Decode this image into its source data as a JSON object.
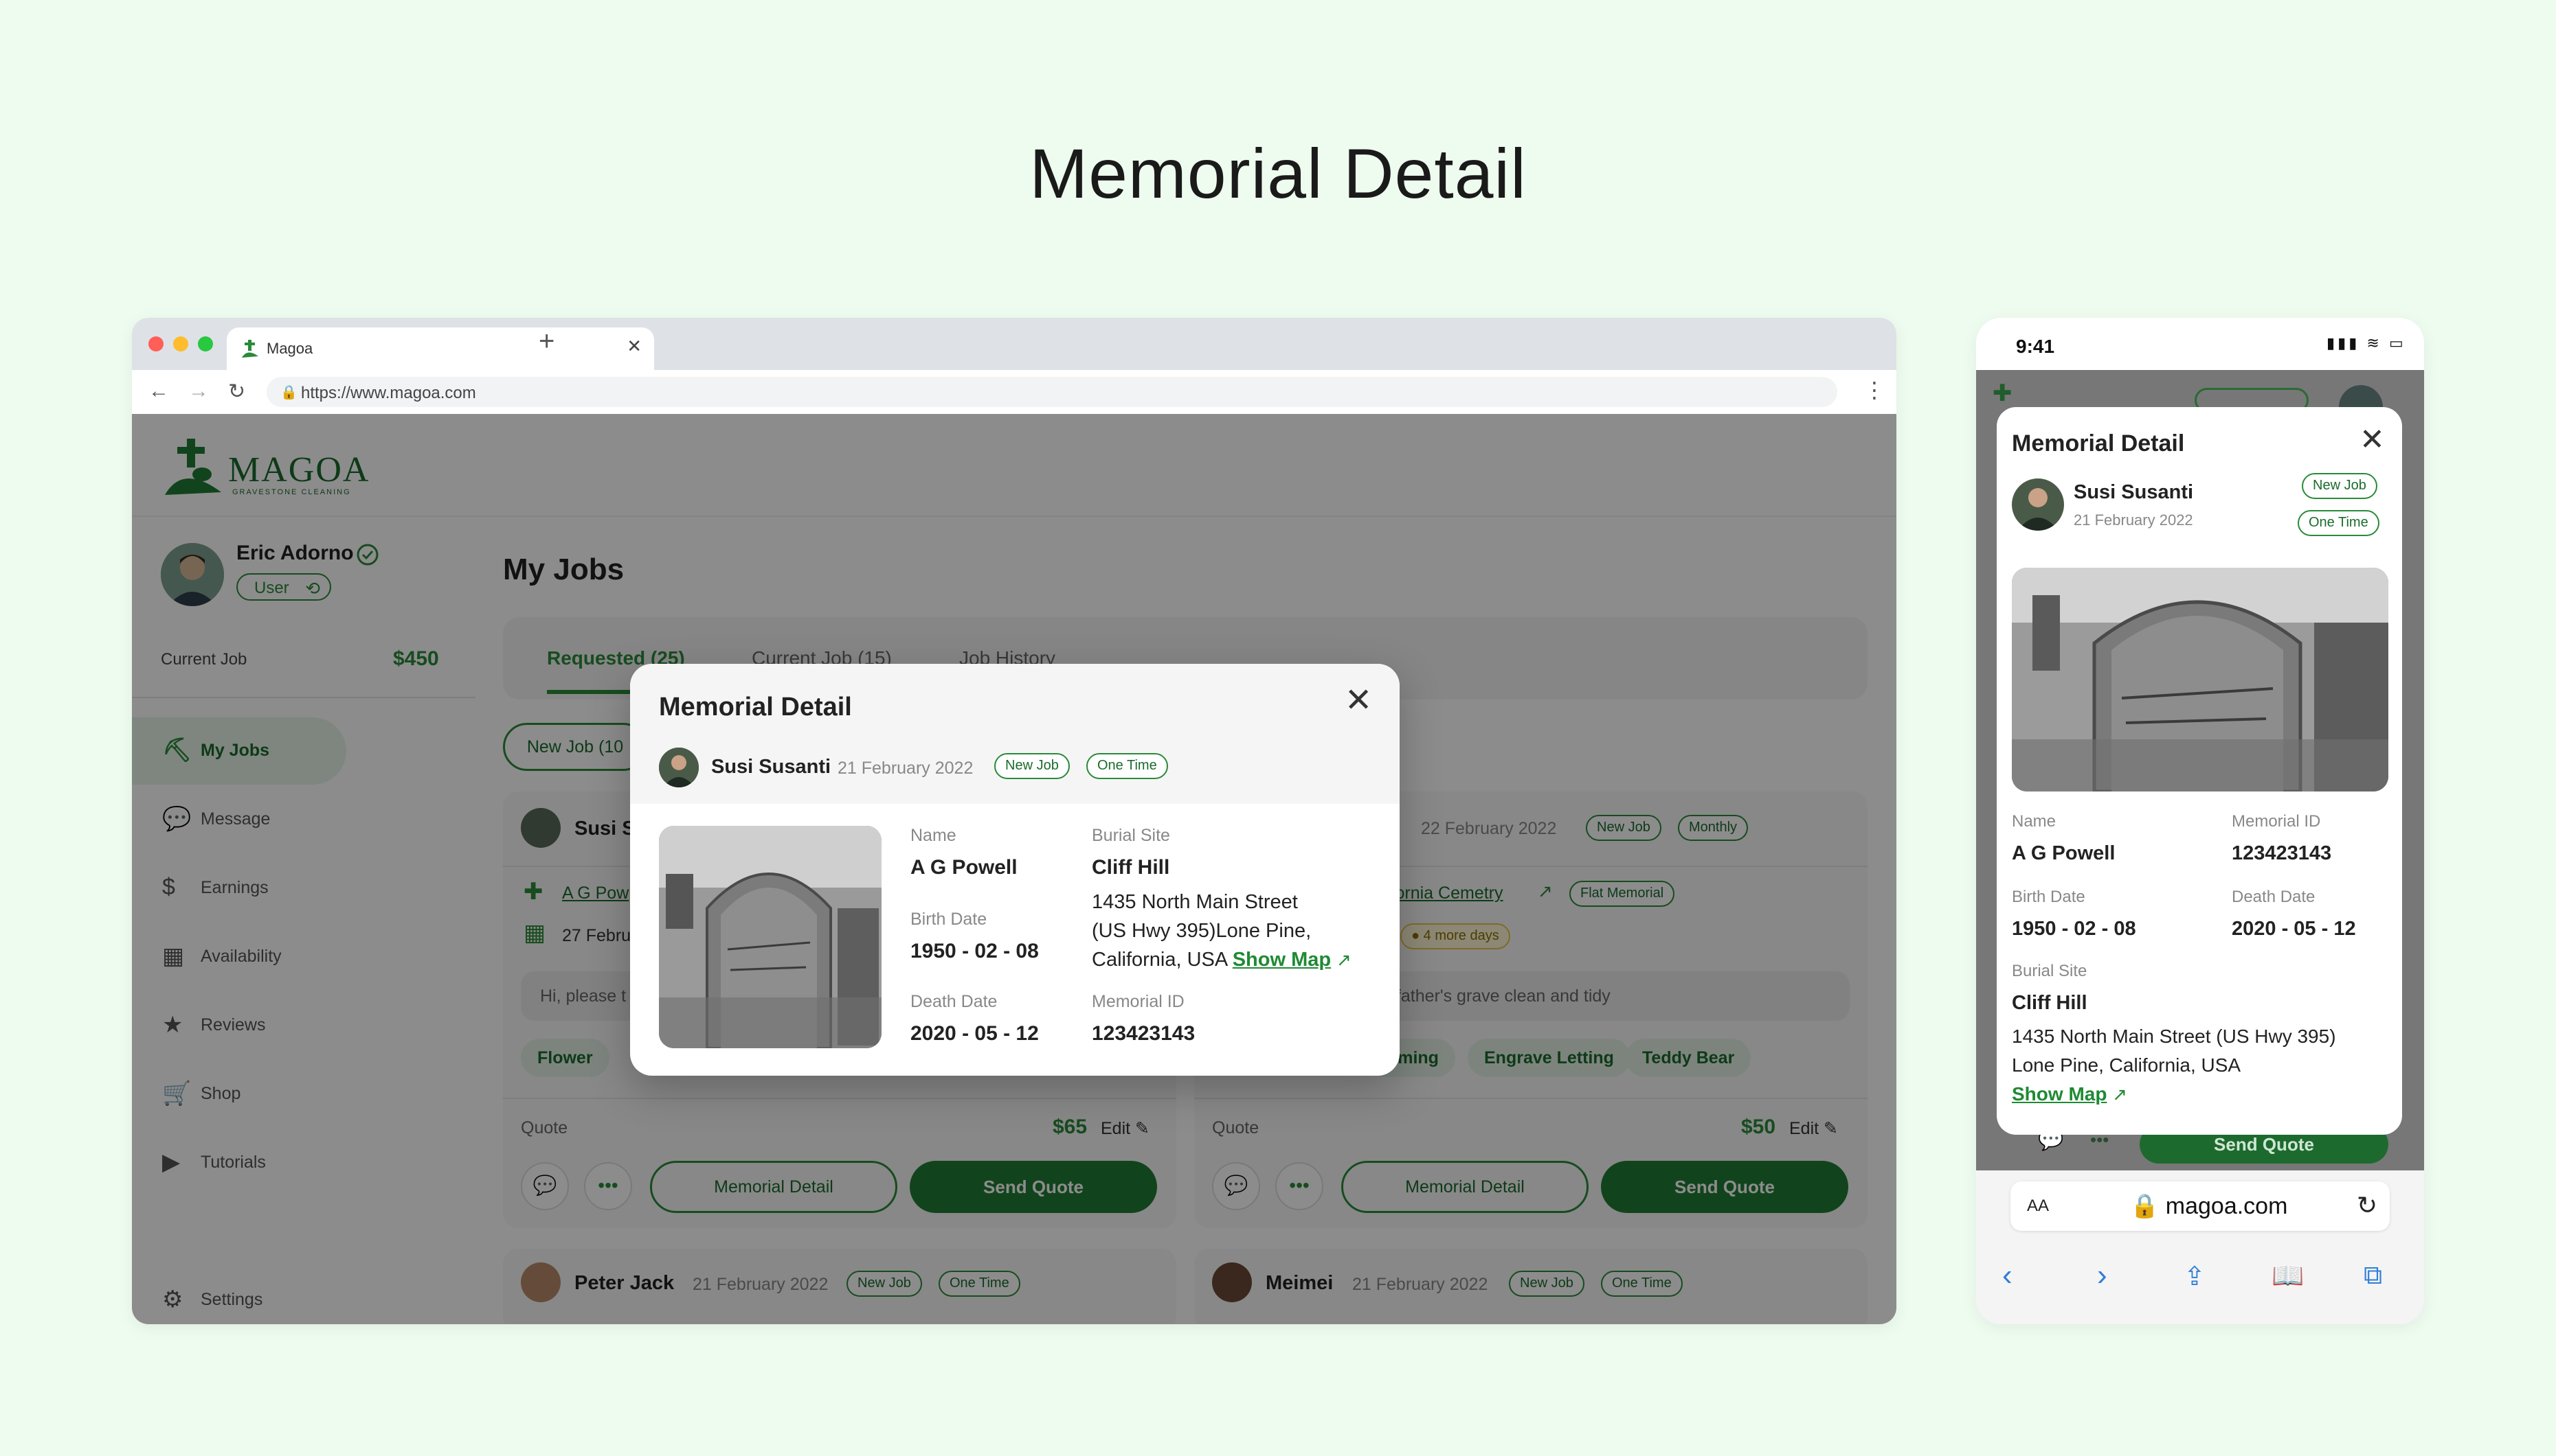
{
  "page_title": "Memorial Detail",
  "browser": {
    "tab_title": "Magoa",
    "tab_close": "✕",
    "new_tab": "+",
    "url": "https://www.magoa.com",
    "kebab": "⋮"
  },
  "app": {
    "logo": "MAGOA",
    "logo_sub": "GRAVESTONE CLEANING",
    "user": {
      "name": "Eric Adorno",
      "badge": "User"
    },
    "current_job_label": "Current Job",
    "current_job_amount": "$450",
    "sidebar": [
      {
        "label": "My Jobs",
        "icon": "broom-icon",
        "glyph": "⛏"
      },
      {
        "label": "Message",
        "icon": "message-icon",
        "glyph": "💬"
      },
      {
        "label": "Earnings",
        "icon": "dollar-icon",
        "glyph": "$"
      },
      {
        "label": "Availability",
        "icon": "calendar-icon",
        "glyph": "▦"
      },
      {
        "label": "Reviews",
        "icon": "star-icon",
        "glyph": "★"
      },
      {
        "label": "Shop",
        "icon": "cart-icon",
        "glyph": "🛒"
      },
      {
        "label": "Tutorials",
        "icon": "play-icon",
        "glyph": "▶"
      }
    ],
    "settings_label": "Settings",
    "main": {
      "heading": "My Jobs",
      "tabs": [
        "Requested (25)",
        "Current Job (15)",
        "Job History"
      ],
      "filter_chip": "New Job (10",
      "cards": [
        {
          "name": "Susi S",
          "location": "A G Pow",
          "date": "27 Febru",
          "message": "Hi, please t",
          "chip": "Flower",
          "quote_label": "Quote",
          "quote_amount": "$65",
          "edit": "Edit",
          "detail_btn": "Memorial Detail",
          "send_btn": "Send Quote"
        },
        {
          "date": "22 February 2022",
          "tags": [
            "New Job",
            "Monthly"
          ],
          "location": "ifornia Cemetry",
          "location_tag": "Flat Memorial",
          "days_tag": "4 more days",
          "message": "dfather's grave clean and tidy",
          "chips": [
            "mming",
            "Engrave Letting",
            "Teddy Bear"
          ],
          "quote_label": "Quote",
          "quote_amount": "$50",
          "edit": "Edit",
          "detail_btn": "Memorial Detail",
          "send_btn": "Send Quote"
        }
      ],
      "bottom_cards": [
        {
          "name": "Peter Jack",
          "date": "21 February 2022",
          "tags": [
            "New Job",
            "One Time"
          ]
        },
        {
          "name": "Meimei",
          "date": "21 February 2022",
          "tags": [
            "New Job",
            "One Time"
          ]
        }
      ]
    }
  },
  "modal": {
    "title": "Memorial Detail",
    "close": "✕",
    "person": "Susi Susanti",
    "date": "21 February 2022",
    "tags": [
      "New Job",
      "One Time"
    ],
    "name_label": "Name",
    "name_value": "A G Powell",
    "birth_label": "Birth Date",
    "birth_value": "1950 - 02 - 08",
    "death_label": "Death Date",
    "death_value": "2020 - 05 - 12",
    "burial_label": "Burial Site",
    "burial_value": "Cliff Hill",
    "address_line1": "1435 North Main Street",
    "address_line2": "(US Hwy 395)Lone Pine,",
    "address_line3": "California, USA",
    "show_map": "Show Map",
    "memorial_id_label": "Memorial ID",
    "memorial_id_value": "123423143"
  },
  "mobile": {
    "time": "9:41",
    "status": "▮▮▮ ≋ ▭",
    "modal_title": "Memorial Detail",
    "person": "Susi Susanti",
    "date": "21 February 2022",
    "tags": [
      "New Job",
      "One Time"
    ],
    "name_label": "Name",
    "name_value": "A G Powell",
    "memorial_id_label": "Memorial ID",
    "memorial_id_value": "123423143",
    "birth_label": "Birth Date",
    "birth_value": "1950 - 02 - 08",
    "death_label": "Death Date",
    "death_value": "2020 - 05 - 12",
    "burial_label": "Burial Site",
    "burial_value": "Cliff Hill",
    "address_line1": "1435 North Main Street (US Hwy 395)",
    "address_line2": "Lone Pine, California, USA",
    "show_map": "Show Map",
    "send_quote": "Send Quote",
    "url_aa": "AA",
    "url": "magoa.com"
  },
  "colors": {
    "accent": "#1f7d33",
    "background": "#eefbef"
  }
}
